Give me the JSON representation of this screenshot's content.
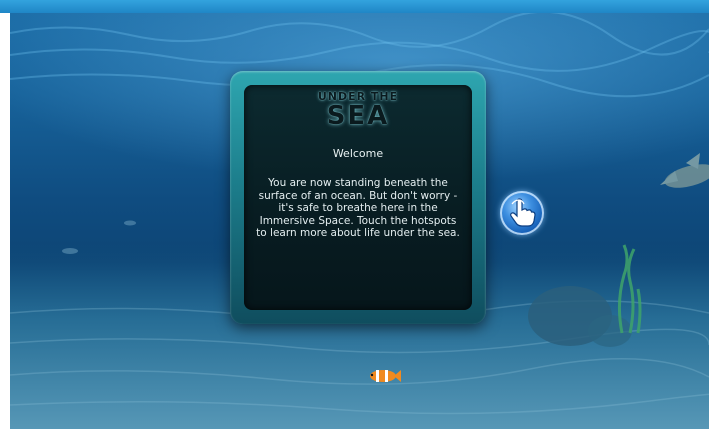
{
  "panel": {
    "logo_line1": "UNDER THE",
    "logo_line2": "SEA",
    "title": "Welcome",
    "body": "You are now standing beneath the surface of an ocean. But don't worry - it's safe to breathe here in the Immersive Space. Touch the hotspots to learn more about life under the sea."
  },
  "hotspot": {
    "icon": "tap-hand-icon"
  },
  "colors": {
    "top_bar": "#2a97d6",
    "water": "#0f4c80",
    "panel_frame": "#1c7d8b",
    "panel_inner": "#081d22",
    "hotspot": "#1f6fcc"
  }
}
